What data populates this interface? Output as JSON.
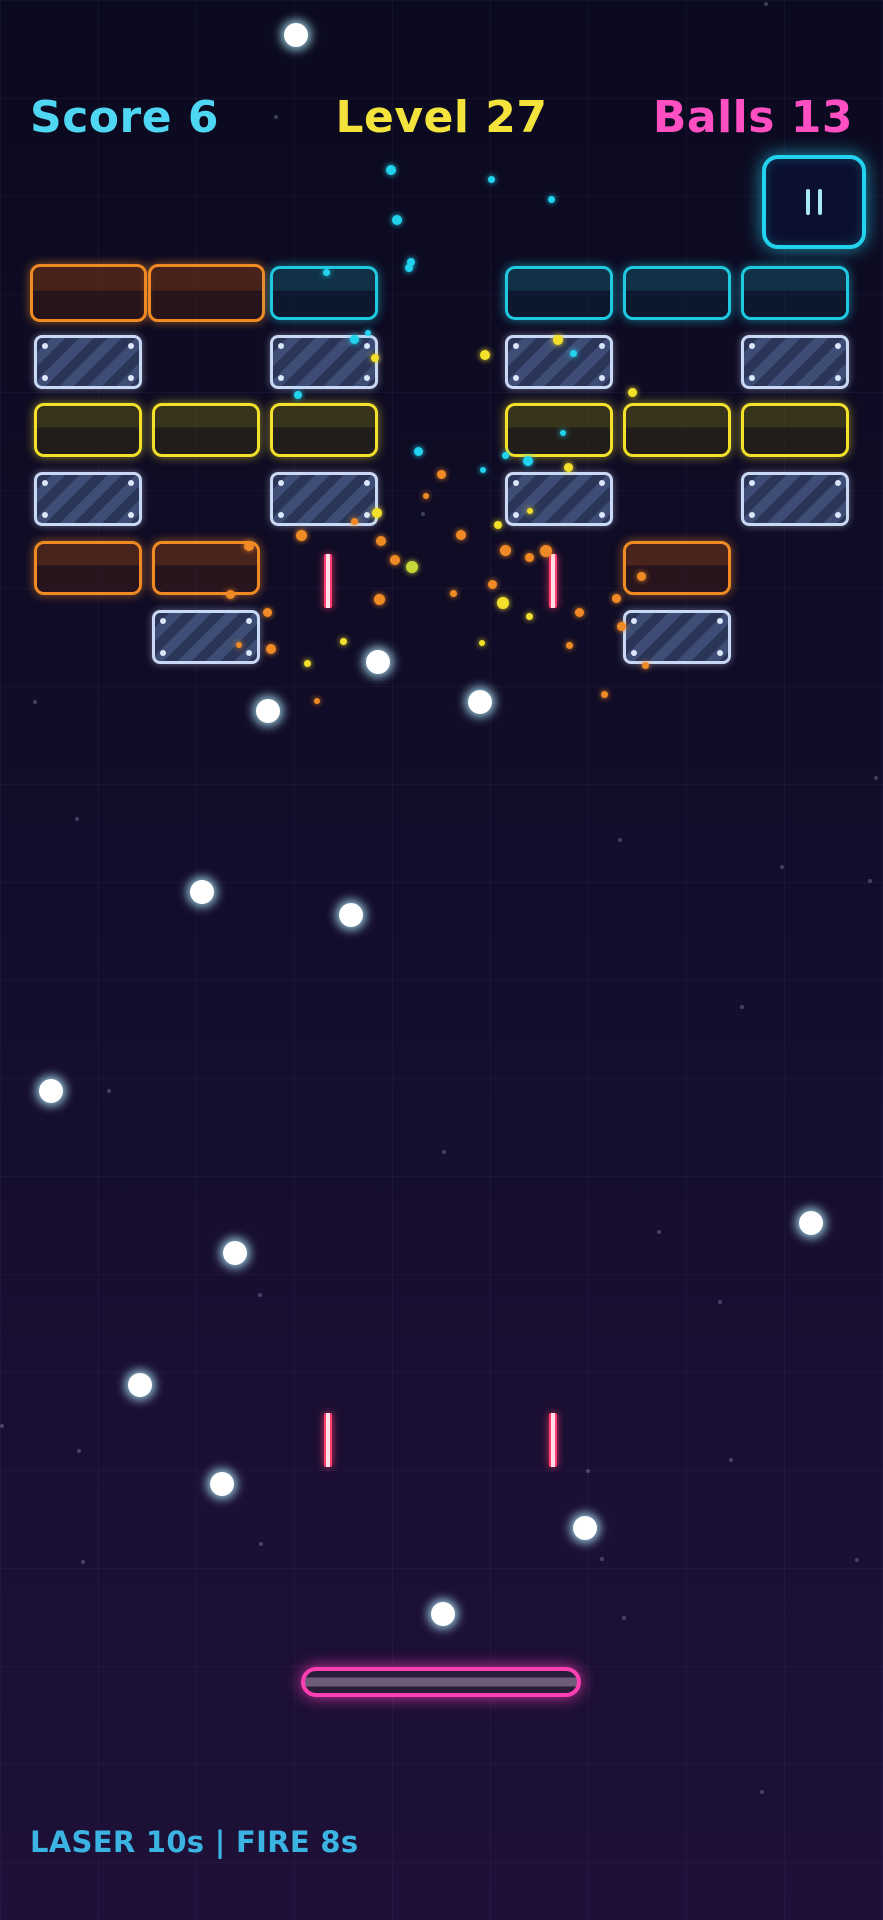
{
  "hud": {
    "score_label": "Score 6",
    "level_label": "Level 27",
    "balls_label": "Balls 13",
    "score_color": "#4fd6f2",
    "level_color": "#f3e33c",
    "balls_color": "#ff4fc2"
  },
  "pause_button": {
    "icon": "pause-icon"
  },
  "status": {
    "powerups_text": "LASER 10s | FIRE 8s",
    "color": "#3bb4e3"
  },
  "bricks": {
    "types": [
      "orange",
      "cyan",
      "yellow",
      "steel"
    ],
    "colors": {
      "orange": "#f08a24",
      "cyan": "#20c8e0",
      "yellow": "#f2e02a",
      "steel": "#c9d8f4"
    }
  },
  "paddle": {
    "color": "#ff3fb4"
  },
  "ball": {
    "color": "#ffffff"
  },
  "powerups_active": [
    "LASER",
    "FIRE"
  ]
}
